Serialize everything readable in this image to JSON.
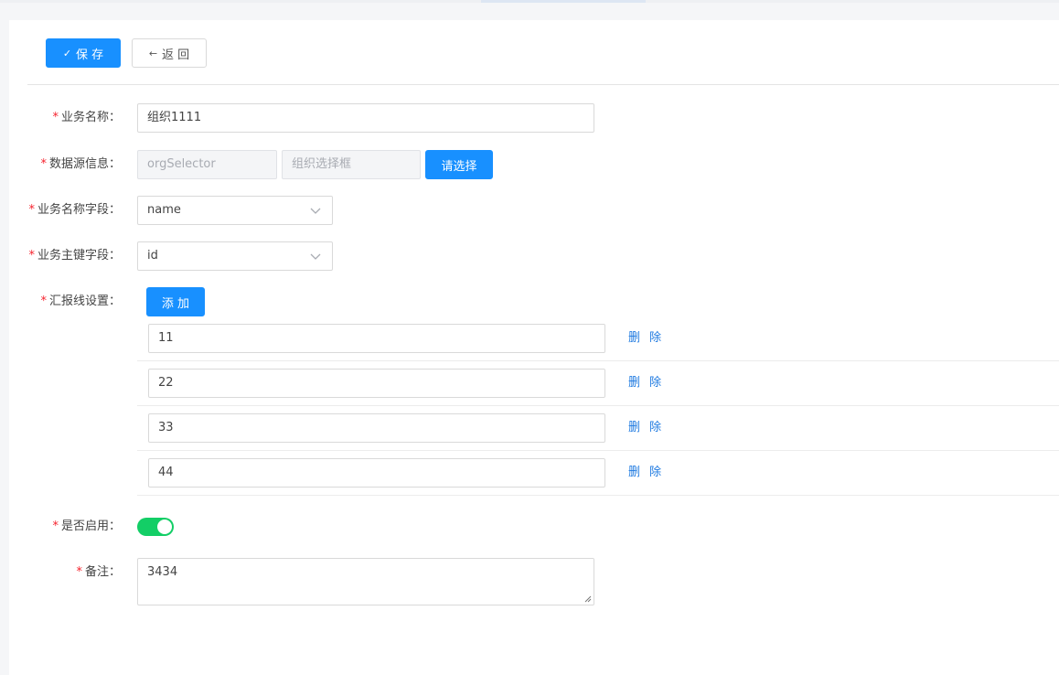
{
  "toolbar": {
    "save_label": "保 存",
    "back_label": "返 回"
  },
  "form": {
    "business_name": {
      "label": "业务名称：",
      "value": "组织1111"
    },
    "datasource": {
      "label": "数据源信息：",
      "value": "orgSelector",
      "selector_placeholder": "组织选择框",
      "choose_button": "请选择"
    },
    "name_field": {
      "label": "业务名称字段：",
      "value": "name"
    },
    "key_field": {
      "label": "业务主键字段：",
      "value": "id"
    },
    "report_line": {
      "label": "汇报线设置：",
      "add_button": "添 加",
      "delete_label": "删 除",
      "items": [
        "11",
        "22",
        "33",
        "44"
      ]
    },
    "enabled": {
      "label": "是否启用：",
      "on": true
    },
    "remark": {
      "label": "备注：",
      "value": "3434"
    }
  },
  "required_mark": "*",
  "colors": {
    "primary": "#1890ff",
    "switch_on": "#13ce66",
    "required": "#f5222d",
    "link": "#1f7ae0"
  }
}
